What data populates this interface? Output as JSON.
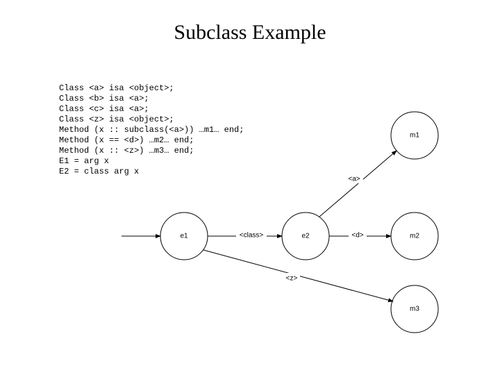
{
  "title": "Subclass Example",
  "code": {
    "l1": "Class <a> isa <object>;",
    "l2": "Class <b> isa <a>;",
    "l3": "Class <c> isa <a>;",
    "l4": "Class <z> isa <object>;",
    "l5": "Method (x :: subclass(<a>)) …m1… end;",
    "l6": "Method (x == <d>) …m2… end;",
    "l7": "Method (x :: <z>) …m3… end;",
    "l8": "E1 = arg x",
    "l9": "E2 = class arg x"
  },
  "graph": {
    "nodes": {
      "e1": "e1",
      "e2": "e2",
      "m1": "m1",
      "m2": "m2",
      "m3": "m3"
    },
    "edge_labels": {
      "class": "<class>",
      "a": "<a>",
      "d": "<d>",
      "z": "<z>"
    }
  }
}
